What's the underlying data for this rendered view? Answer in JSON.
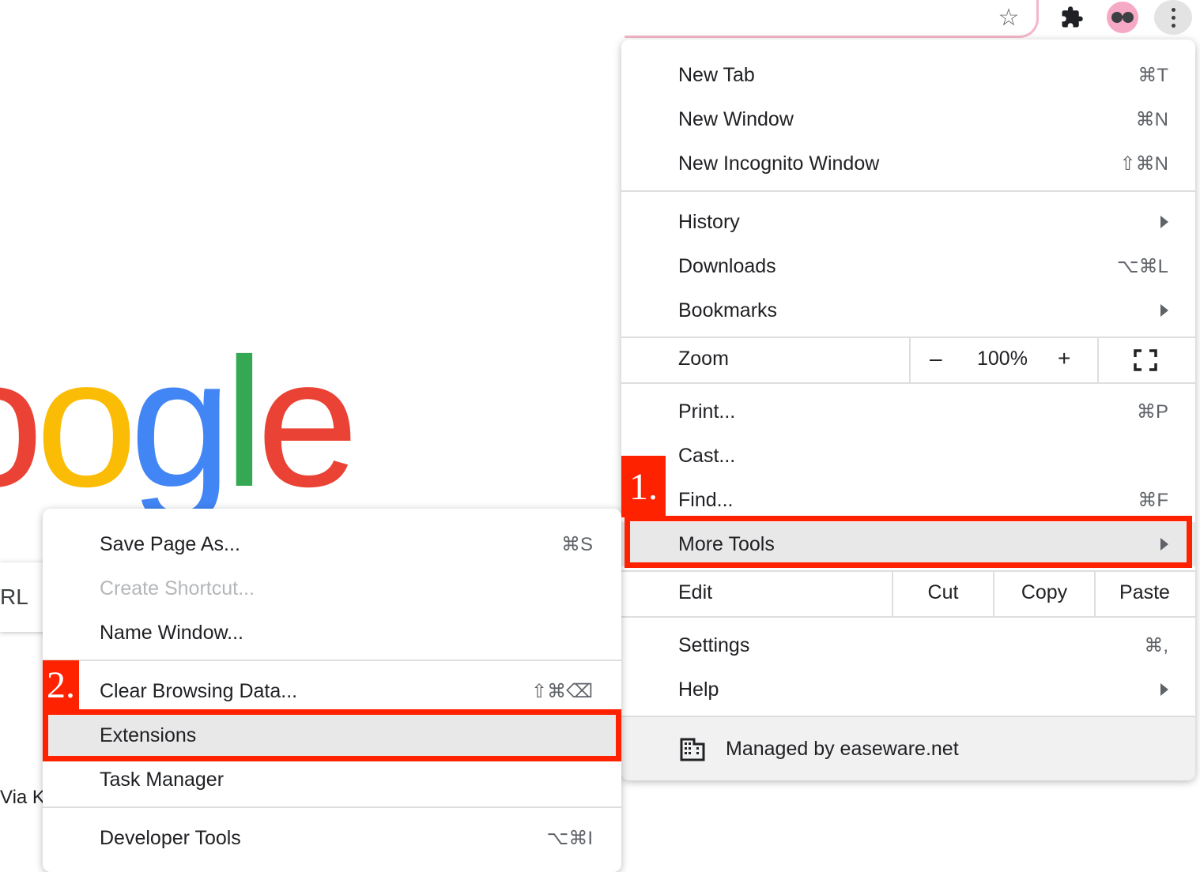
{
  "main_menu": {
    "new_tab": {
      "label": "New Tab",
      "shortcut": "⌘T"
    },
    "new_window": {
      "label": "New Window",
      "shortcut": "⌘N"
    },
    "new_incognito": {
      "label": "New Incognito Window",
      "shortcut": "⇧⌘N"
    },
    "history": {
      "label": "History"
    },
    "downloads": {
      "label": "Downloads",
      "shortcut": "⌥⌘L"
    },
    "bookmarks": {
      "label": "Bookmarks"
    },
    "zoom": {
      "label": "Zoom",
      "minus": "–",
      "value": "100%",
      "plus": "+"
    },
    "print": {
      "label": "Print...",
      "shortcut": "⌘P"
    },
    "cast": {
      "label": "Cast..."
    },
    "find": {
      "label": "Find...",
      "shortcut": "⌘F"
    },
    "more_tools": {
      "label": "More Tools"
    },
    "edit": {
      "label": "Edit",
      "cut": "Cut",
      "copy": "Copy",
      "paste": "Paste"
    },
    "settings": {
      "label": "Settings",
      "shortcut": "⌘,"
    },
    "help": {
      "label": "Help"
    },
    "managed": {
      "label": "Managed by easeware.net"
    }
  },
  "sub_menu": {
    "save_page": {
      "label": "Save Page As...",
      "shortcut": "⌘S"
    },
    "create_shortcut": {
      "label": "Create Shortcut..."
    },
    "name_window": {
      "label": "Name Window..."
    },
    "clear_data": {
      "label": "Clear Browsing Data...",
      "shortcut": "⇧⌘⌫"
    },
    "extensions": {
      "label": "Extensions"
    },
    "task_manager": {
      "label": "Task Manager"
    },
    "developer_tools": {
      "label": "Developer Tools",
      "shortcut": "⌥⌘I"
    }
  },
  "annotations": {
    "step1": "1.",
    "step2": "2."
  },
  "background": {
    "logo_fragment": [
      "o",
      "o",
      "g",
      "l",
      "e"
    ],
    "url_fragment": "RL",
    "via_fragment": "Via K"
  },
  "colors": {
    "highlight": "#ff2200",
    "profile": "#f5a9c4"
  }
}
